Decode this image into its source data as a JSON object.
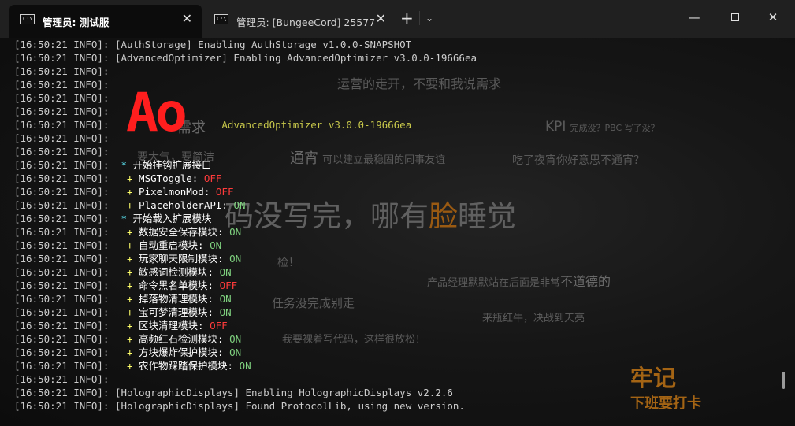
{
  "tabs": [
    {
      "title": "管理员: 测试服",
      "active": true
    },
    {
      "title": "管理员: [BungeeCord] 25577",
      "active": false
    }
  ],
  "tab_icon_glyph": "C:\\",
  "window_controls": {
    "new_tab": "+",
    "dropdown": "⌄",
    "minimize": "—",
    "close": "✕"
  },
  "watermark": {
    "line1": "运营的走开，不要和我说需求",
    "needs": "需求",
    "mess": "要大气，要简洁",
    "kpi_big": "KPI",
    "kpi_small": "完成没？PBC 写了没？",
    "tongxiao_big": "通宵",
    "tongxiao_small": "可以建立最稳固的同事友谊",
    "supper": "吃了夜宵你好意思不通宵？",
    "big_prefix": "码没写完，哪有",
    "big_face": "脸",
    "big_suffix": "睡觉",
    "test": "检！",
    "pm": "产品经理默默站在后面是非常",
    "pm_bold": "不道德的",
    "task": "任务没完成别走",
    "redbull": "来瓶红牛，决战到天亮",
    "code": "我要裸着写代码，这样很放松！",
    "stamp_title": "牢记",
    "stamp_sub": "下班要打卡"
  },
  "logo_text": "Ao",
  "log_lines": [
    {
      "prefix": "[16:50:21 INFO]: ",
      "segments": [
        {
          "text": "[AuthStorage] Enabling AuthStorage v1.0.0-SNAPSHOT",
          "color": "default"
        }
      ]
    },
    {
      "prefix": "[16:50:21 INFO]: ",
      "segments": [
        {
          "text": "[AdvancedOptimizer] Enabling AdvancedOptimizer v3.0.0-19666ea",
          "color": "default"
        }
      ]
    },
    {
      "prefix": "[16:50:21 INFO]: ",
      "segments": []
    },
    {
      "prefix": "[16:50:21 INFO]: ",
      "segments": []
    },
    {
      "prefix": "[16:50:21 INFO]: ",
      "segments": []
    },
    {
      "prefix": "[16:50:21 INFO]: ",
      "segments": []
    },
    {
      "prefix": "[16:50:21 INFO]: ",
      "segments": [
        {
          "text": "                  AdvancedOptimizer v3.0.0-19666ea",
          "color": "olive"
        }
      ]
    },
    {
      "prefix": "[16:50:21 INFO]: ",
      "segments": []
    },
    {
      "prefix": "[16:50:21 INFO]: ",
      "segments": []
    },
    {
      "prefix": "[16:50:21 INFO]: ",
      "segments": [
        {
          "text": " * ",
          "color": "cyan"
        },
        {
          "text": "开始挂钩扩展接口",
          "color": "white"
        }
      ]
    },
    {
      "prefix": "[16:50:21 INFO]: ",
      "segments": [
        {
          "text": "  + ",
          "color": "yellow"
        },
        {
          "text": "MSGToggle: ",
          "color": "white"
        },
        {
          "text": "OFF",
          "color": "red"
        }
      ]
    },
    {
      "prefix": "[16:50:21 INFO]: ",
      "segments": [
        {
          "text": "  + ",
          "color": "yellow"
        },
        {
          "text": "PixelmonMod: ",
          "color": "white"
        },
        {
          "text": "OFF",
          "color": "red"
        }
      ]
    },
    {
      "prefix": "[16:50:21 INFO]: ",
      "segments": [
        {
          "text": "  + ",
          "color": "yellow"
        },
        {
          "text": "PlaceholderAPI: ",
          "color": "white"
        },
        {
          "text": "ON",
          "color": "green"
        }
      ]
    },
    {
      "prefix": "[16:50:21 INFO]: ",
      "segments": [
        {
          "text": " * ",
          "color": "cyan"
        },
        {
          "text": "开始载入扩展模块",
          "color": "white"
        }
      ]
    },
    {
      "prefix": "[16:50:21 INFO]: ",
      "segments": [
        {
          "text": "  + ",
          "color": "yellow"
        },
        {
          "text": "数据安全保存模块: ",
          "color": "white"
        },
        {
          "text": "ON",
          "color": "green"
        }
      ]
    },
    {
      "prefix": "[16:50:21 INFO]: ",
      "segments": [
        {
          "text": "  + ",
          "color": "yellow"
        },
        {
          "text": "自动重启模块: ",
          "color": "white"
        },
        {
          "text": "ON",
          "color": "green"
        }
      ]
    },
    {
      "prefix": "[16:50:21 INFO]: ",
      "segments": [
        {
          "text": "  + ",
          "color": "yellow"
        },
        {
          "text": "玩家聊天限制模块: ",
          "color": "white"
        },
        {
          "text": "ON",
          "color": "green"
        }
      ]
    },
    {
      "prefix": "[16:50:21 INFO]: ",
      "segments": [
        {
          "text": "  + ",
          "color": "yellow"
        },
        {
          "text": "敏感词检测模块: ",
          "color": "white"
        },
        {
          "text": "ON",
          "color": "green"
        }
      ]
    },
    {
      "prefix": "[16:50:21 INFO]: ",
      "segments": [
        {
          "text": "  + ",
          "color": "yellow"
        },
        {
          "text": "命令黑名单模块: ",
          "color": "white"
        },
        {
          "text": "OFF",
          "color": "red"
        }
      ]
    },
    {
      "prefix": "[16:50:21 INFO]: ",
      "segments": [
        {
          "text": "  + ",
          "color": "yellow"
        },
        {
          "text": "掉落物清理模块: ",
          "color": "white"
        },
        {
          "text": "ON",
          "color": "green"
        }
      ]
    },
    {
      "prefix": "[16:50:21 INFO]: ",
      "segments": [
        {
          "text": "  + ",
          "color": "yellow"
        },
        {
          "text": "宝可梦清理模块: ",
          "color": "white"
        },
        {
          "text": "ON",
          "color": "green"
        }
      ]
    },
    {
      "prefix": "[16:50:21 INFO]: ",
      "segments": [
        {
          "text": "  + ",
          "color": "yellow"
        },
        {
          "text": "区块清理模块: ",
          "color": "white"
        },
        {
          "text": "OFF",
          "color": "red"
        }
      ]
    },
    {
      "prefix": "[16:50:21 INFO]: ",
      "segments": [
        {
          "text": "  + ",
          "color": "yellow"
        },
        {
          "text": "高频红石检测模块: ",
          "color": "white"
        },
        {
          "text": "ON",
          "color": "green"
        }
      ]
    },
    {
      "prefix": "[16:50:21 INFO]: ",
      "segments": [
        {
          "text": "  + ",
          "color": "yellow"
        },
        {
          "text": "方块爆炸保护模块: ",
          "color": "white"
        },
        {
          "text": "ON",
          "color": "green"
        }
      ]
    },
    {
      "prefix": "[16:50:21 INFO]: ",
      "segments": [
        {
          "text": "  + ",
          "color": "yellow"
        },
        {
          "text": "农作物踩踏保护模块: ",
          "color": "white"
        },
        {
          "text": "ON",
          "color": "green"
        }
      ]
    },
    {
      "prefix": "[16:50:21 INFO]: ",
      "segments": []
    },
    {
      "prefix": "[16:50:21 INFO]: ",
      "segments": [
        {
          "text": "[HolographicDisplays] Enabling HolographicDisplays v2.2.6",
          "color": "default"
        }
      ]
    },
    {
      "prefix": "[16:50:21 INFO]: ",
      "segments": [
        {
          "text": "[HolographicDisplays] Found ProtocolLib, using new version.",
          "color": "default"
        }
      ]
    }
  ],
  "colors": {
    "red": "#ff3b3b",
    "green": "#7fd27f",
    "yellow": "#ffff6a",
    "cyan": "#5ff0ff",
    "olive": "#c7c74a",
    "white": "#ffffff",
    "default": "#cccccc"
  }
}
